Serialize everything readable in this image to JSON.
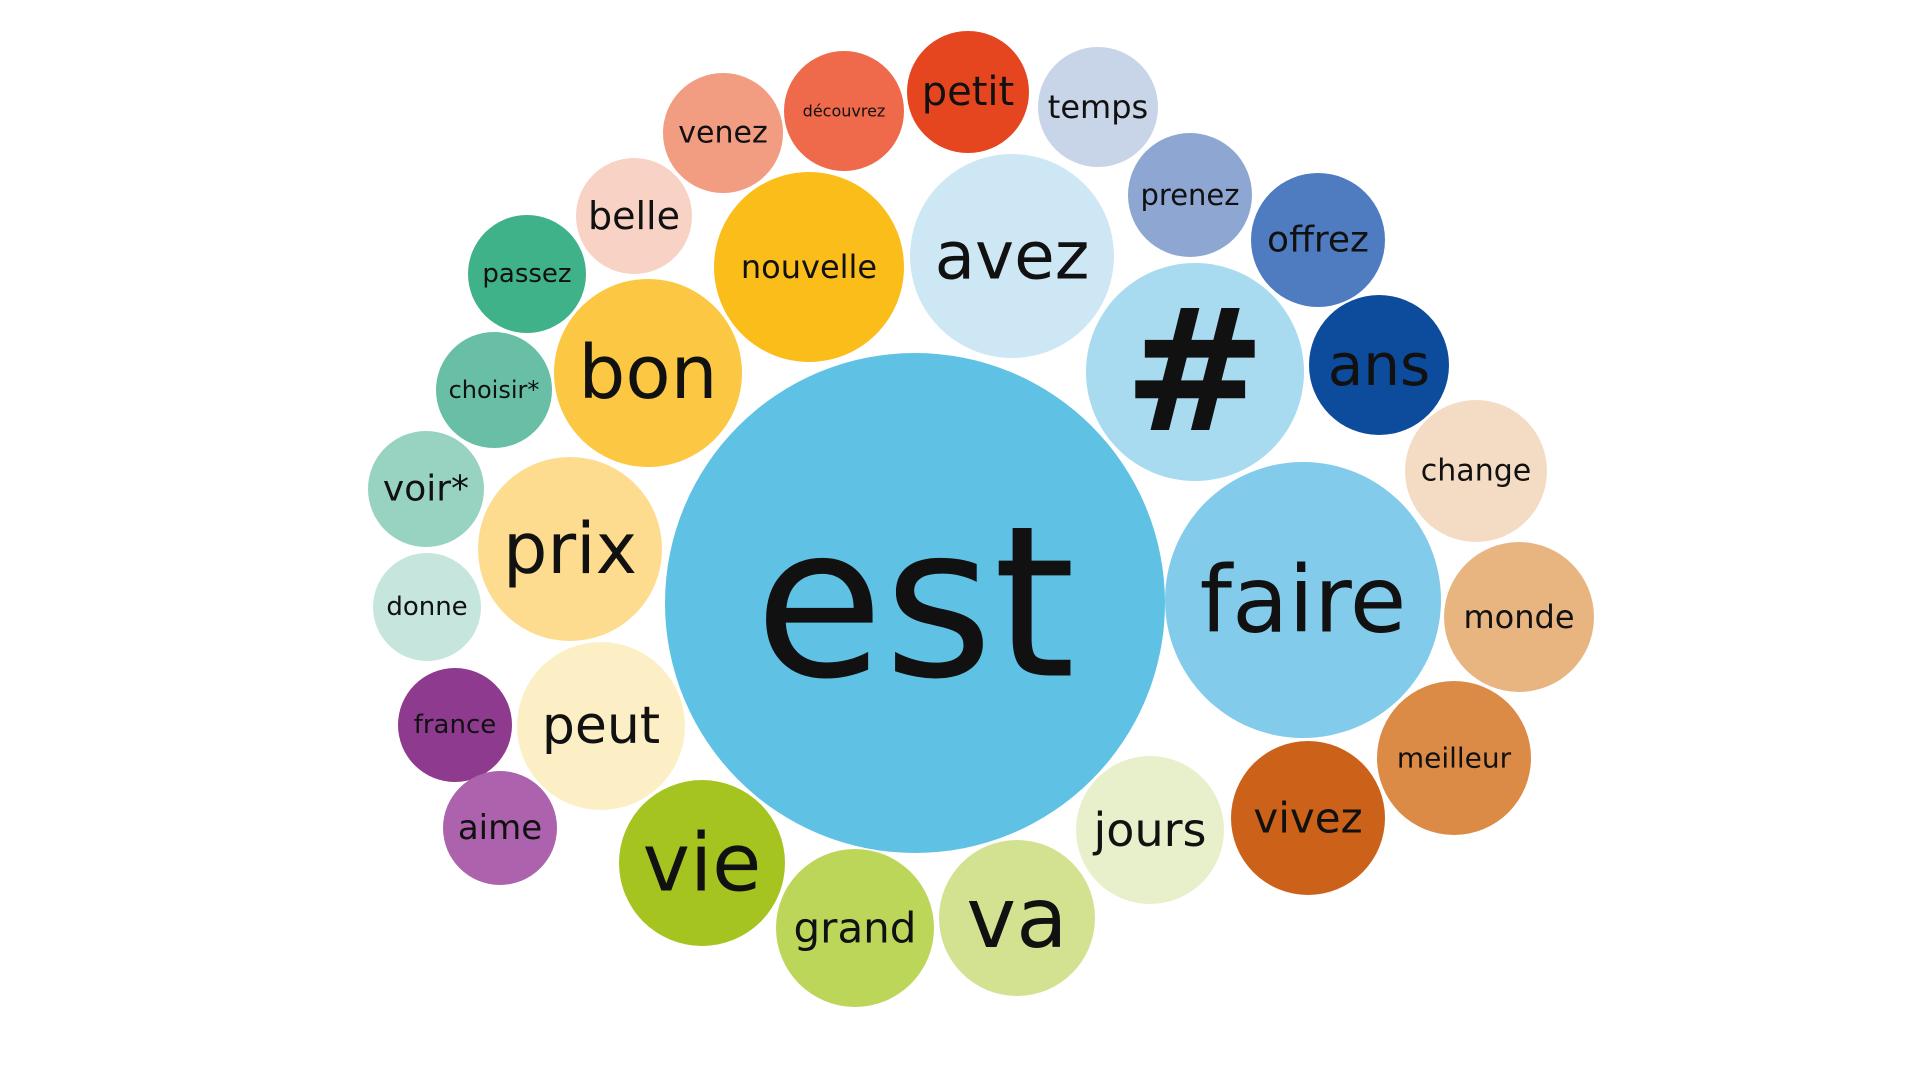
{
  "colors": {
    "background": "#ffffff",
    "text": "#111111"
  },
  "chart_data": {
    "type": "bubble",
    "title": "",
    "series": [
      {
        "word": "est",
        "color": "#5fc2e4"
      },
      {
        "word": "faire",
        "color": "#82cbeb"
      },
      {
        "word": "#",
        "color": "#a8dbf0"
      },
      {
        "word": "avez",
        "color": "#cde8f4"
      },
      {
        "word": "ans",
        "color": "#0d4c9c"
      },
      {
        "word": "offrez",
        "color": "#4f7cc1"
      },
      {
        "word": "prenez",
        "color": "#8ea7d2"
      },
      {
        "word": "temps",
        "color": "#c8d4e7"
      },
      {
        "word": "petit",
        "color": "#e5451f"
      },
      {
        "word": "découvrez",
        "color": "#ee6a4a"
      },
      {
        "word": "venez",
        "color": "#f29c82"
      },
      {
        "word": "belle",
        "color": "#f8d2c4"
      },
      {
        "word": "nouvelle",
        "color": "#fbbd1a"
      },
      {
        "word": "bon",
        "color": "#fcc844"
      },
      {
        "word": "prix",
        "color": "#fddc90"
      },
      {
        "word": "peut",
        "color": "#fdefc5"
      },
      {
        "word": "passez",
        "color": "#3fb28a"
      },
      {
        "word": "choisir*",
        "color": "#68bfa5"
      },
      {
        "word": "voir*",
        "color": "#98d2c1"
      },
      {
        "word": "donne",
        "color": "#c6e6dd"
      },
      {
        "word": "france",
        "color": "#8e3a8e"
      },
      {
        "word": "aime",
        "color": "#ad62ad"
      },
      {
        "word": "vie",
        "color": "#a5c420"
      },
      {
        "word": "grand",
        "color": "#bcd65a"
      },
      {
        "word": "va",
        "color": "#d2e290"
      },
      {
        "word": "jours",
        "color": "#e8f0cb"
      },
      {
        "word": "vivez",
        "color": "#cc6119"
      },
      {
        "word": "meilleur",
        "color": "#dc8b46"
      },
      {
        "word": "monde",
        "color": "#e8b581"
      },
      {
        "word": "change",
        "color": "#f4dcc4"
      }
    ]
  }
}
